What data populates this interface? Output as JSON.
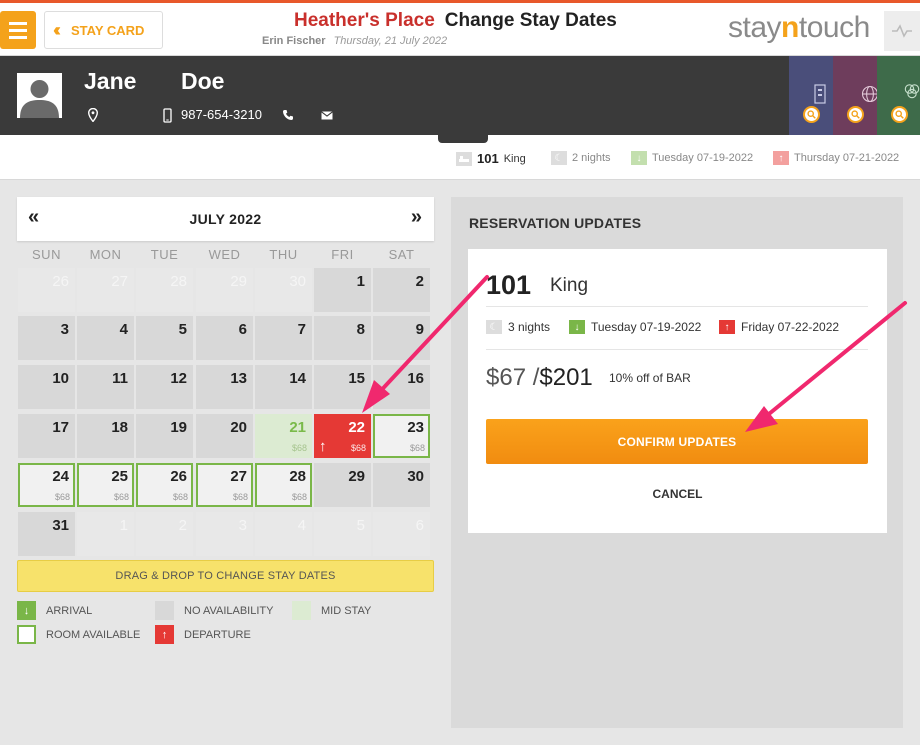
{
  "header": {
    "back_label": "STAY CARD",
    "hotel_name": "Heather's Place",
    "page_title": "Change Stay Dates",
    "user_name": "Erin Fischer",
    "business_date": "Thursday, 21 July 2022",
    "logo_prefix": "stay",
    "logo_n": "n",
    "logo_suffix": "touch"
  },
  "guest": {
    "first_name": "Jane",
    "last_name": "Doe",
    "phone": "987-654-3210"
  },
  "summary": {
    "room_number": "101",
    "room_type": "King",
    "nights": "2 nights",
    "arrival": "Tuesday 07-19-2022",
    "departure": "Thursday 07-21-2022"
  },
  "calendar": {
    "month_label": "JULY 2022",
    "prev_icon": "«",
    "next_icon": "»",
    "weekdays": [
      "SUN",
      "MON",
      "TUE",
      "WED",
      "THU",
      "FRI",
      "SAT"
    ],
    "weeks": [
      [
        {
          "d": "26",
          "s": "other"
        },
        {
          "d": "27",
          "s": "other"
        },
        {
          "d": "28",
          "s": "other"
        },
        {
          "d": "29",
          "s": "other"
        },
        {
          "d": "30",
          "s": "other"
        },
        {
          "d": "1",
          "s": "na"
        },
        {
          "d": "2",
          "s": "na"
        }
      ],
      [
        {
          "d": "3",
          "s": "na"
        },
        {
          "d": "4",
          "s": "na"
        },
        {
          "d": "5",
          "s": "na"
        },
        {
          "d": "6",
          "s": "na"
        },
        {
          "d": "7",
          "s": "na"
        },
        {
          "d": "8",
          "s": "na"
        },
        {
          "d": "9",
          "s": "na"
        }
      ],
      [
        {
          "d": "10",
          "s": "na"
        },
        {
          "d": "11",
          "s": "na"
        },
        {
          "d": "12",
          "s": "na"
        },
        {
          "d": "13",
          "s": "na"
        },
        {
          "d": "14",
          "s": "na"
        },
        {
          "d": "15",
          "s": "na"
        },
        {
          "d": "16",
          "s": "na"
        }
      ],
      [
        {
          "d": "17",
          "s": "na"
        },
        {
          "d": "18",
          "s": "na"
        },
        {
          "d": "19",
          "s": "na"
        },
        {
          "d": "20",
          "s": "na"
        },
        {
          "d": "21",
          "s": "mid",
          "p": "$68"
        },
        {
          "d": "22",
          "s": "dep",
          "p": "$68"
        },
        {
          "d": "23",
          "s": "avail",
          "p": "$68"
        }
      ],
      [
        {
          "d": "24",
          "s": "avail",
          "p": "$68"
        },
        {
          "d": "25",
          "s": "avail",
          "p": "$68"
        },
        {
          "d": "26",
          "s": "avail",
          "p": "$68"
        },
        {
          "d": "27",
          "s": "avail",
          "p": "$68"
        },
        {
          "d": "28",
          "s": "avail",
          "p": "$68"
        },
        {
          "d": "29",
          "s": "na"
        },
        {
          "d": "30",
          "s": "na"
        }
      ],
      [
        {
          "d": "31",
          "s": "na"
        },
        {
          "d": "1",
          "s": "other"
        },
        {
          "d": "2",
          "s": "other"
        },
        {
          "d": "3",
          "s": "other"
        },
        {
          "d": "4",
          "s": "other"
        },
        {
          "d": "5",
          "s": "other"
        },
        {
          "d": "6",
          "s": "other"
        }
      ]
    ],
    "drag_hint": "DRAG & DROP TO CHANGE STAY DATES"
  },
  "legend": {
    "arrival": "ARRIVAL",
    "no_availability": "NO AVAILABILITY",
    "mid_stay": "MID STAY",
    "room_available": "ROOM AVAILABLE",
    "departure": "DEPARTURE"
  },
  "reservation": {
    "panel_title": "RESERVATION UPDATES",
    "room_number": "101",
    "room_type": "King",
    "nights": "3 nights",
    "arrival": "Tuesday 07-19-2022",
    "departure": "Friday 07-22-2022",
    "avg_rate": "$67",
    "slash": " /",
    "total": "$201",
    "discount": "10% off of BAR",
    "confirm_label": "CONFIRM UPDATES",
    "cancel_label": "CANCEL"
  },
  "colors": {
    "accent": "#f4a21b",
    "hotel_title": "#c9302c",
    "departure": "#e53935",
    "arrival": "#7ab648",
    "annotation_arrow": "#f0286e"
  }
}
